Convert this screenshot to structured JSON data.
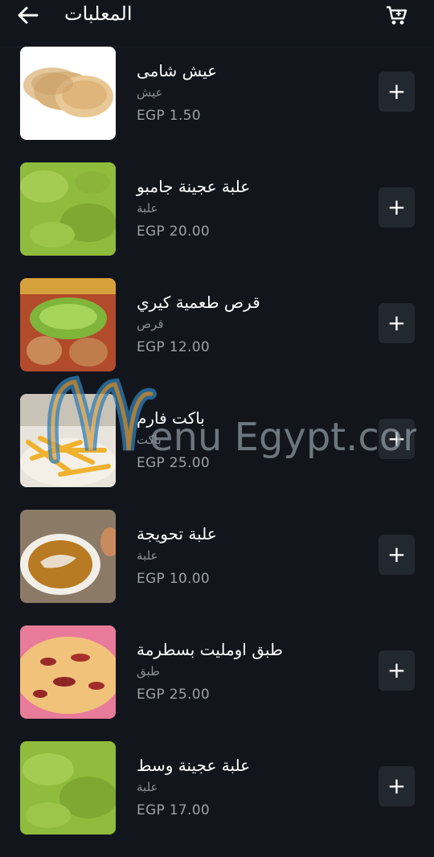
{
  "header": {
    "title": "المعلبات",
    "back_icon": "arrow-left-icon",
    "cart_icon": "cart-icon"
  },
  "items": [
    {
      "name": "عيش شامى",
      "unit": "عيش",
      "price": "EGP 1.50",
      "image": "pita-bread"
    },
    {
      "name": "علبة عجينة جامبو",
      "unit": "علبة",
      "price": "EGP 20.00",
      "image": "falafel-paste"
    },
    {
      "name": "قرص طعمية كيري",
      "unit": "قرص",
      "price": "EGP 12.00",
      "image": "stuffed-falafel"
    },
    {
      "name": "باكت فارم",
      "unit": "باكت",
      "price": "EGP 25.00",
      "image": "fries"
    },
    {
      "name": "علبة تحويجة",
      "unit": "علبة",
      "price": "EGP 10.00",
      "image": "sauce-bowl"
    },
    {
      "name": "طبق اومليت بسطرمة",
      "unit": "طبق",
      "price": "EGP 25.00",
      "image": "pastrami-omelette"
    },
    {
      "name": "علبة عجينة وسط",
      "unit": "علبة",
      "price": "EGP 17.00",
      "image": "falafel-paste"
    }
  ],
  "add_label": "+",
  "watermark": {
    "text": "enu Egypt.com"
  },
  "colors": {
    "background": "#12161c",
    "button": "#22282f",
    "muted": "#8a9099"
  }
}
